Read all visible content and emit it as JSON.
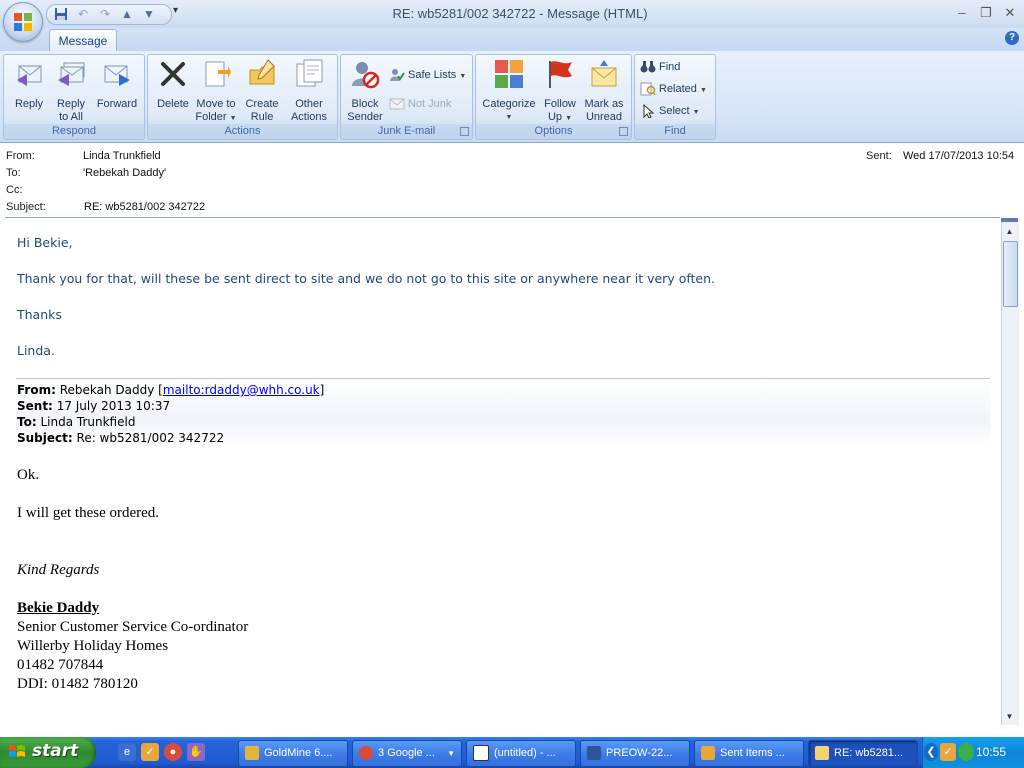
{
  "window": {
    "title": "RE: wb5281/002 342722 - Message (HTML)",
    "minimize": "–",
    "restore": "❐",
    "close": "✕"
  },
  "ribbon": {
    "tab_message": "Message",
    "help": "?",
    "respond": {
      "label": "Respond",
      "reply": "Reply",
      "reply_all_1": "Reply",
      "reply_all_2": "to All",
      "forward": "Forward"
    },
    "actions": {
      "label": "Actions",
      "delete": "Delete",
      "move_1": "Move to",
      "move_2": "Folder",
      "create_1": "Create",
      "create_2": "Rule",
      "other_1": "Other",
      "other_2": "Actions"
    },
    "junk": {
      "label": "Junk E-mail",
      "block_1": "Block",
      "block_2": "Sender",
      "safe_lists": "Safe Lists",
      "not_junk": "Not Junk"
    },
    "options": {
      "label": "Options",
      "categorize": "Categorize",
      "follow_1": "Follow",
      "follow_2": "Up",
      "mark_1": "Mark as",
      "mark_2": "Unread"
    },
    "find": {
      "label": "Find",
      "find": "Find",
      "related": "Related",
      "select": "Select"
    }
  },
  "headers": {
    "from_label": "From:",
    "from": "Linda Trunkfield",
    "to_label": "To:",
    "to": "'Rebekah Daddy'",
    "cc_label": "Cc:",
    "cc": "",
    "subject_label": "Subject:",
    "subject": "RE: wb5281/002 342722",
    "sent_label": "Sent:",
    "sent": "Wed 17/07/2013 10:54"
  },
  "body": {
    "greeting": "Hi Bekie,",
    "line1": "Thank you for that, will these be sent direct to site and we do not go to this site or anywhere near it very often.",
    "thanks": "Thanks",
    "signoff": "Linda.",
    "quoted": {
      "from_label": "From:",
      "from_name": "Rebekah Daddy [",
      "from_mailto": "mailto:rdaddy@whh.co.uk",
      "from_end": "]",
      "sent_label": "Sent:",
      "sent": "17 July 2013 10:37",
      "to_label": "To:",
      "to": "Linda Trunkfield",
      "subject_label": "Subject:",
      "subject": "Re: wb5281/002 342722",
      "ok": "Ok.",
      "line": "I will get these ordered.",
      "regards": "Kind Regards",
      "sig_name": "Bekie Daddy",
      "sig_title": "Senior Customer Service Co-ordinator",
      "sig_company": "Willerby Holiday Homes",
      "sig_phone": "01482 707844",
      "sig_ddi": "DDI: 01482 780120"
    }
  },
  "taskbar": {
    "start": "start",
    "tasks": [
      {
        "label": "GoldMine 6...."
      },
      {
        "label": "3 Google ..."
      },
      {
        "label": "(untitled) - ..."
      },
      {
        "label": "PREOW-22..."
      },
      {
        "label": "Sent Items ..."
      },
      {
        "label": "RE: wb5281..."
      }
    ],
    "clock": "10:55"
  }
}
